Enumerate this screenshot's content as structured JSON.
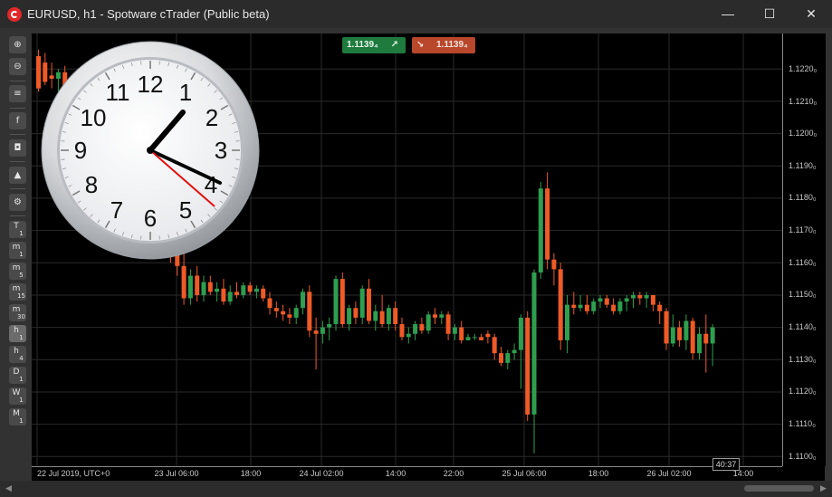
{
  "window": {
    "title": "EURUSD, h1 - Spotware cTrader (Public beta)",
    "minimize_glyph": "—",
    "maximize_glyph": "☐",
    "close_glyph": "✕"
  },
  "toolbar": {
    "tools": [
      {
        "name": "zoom-in-icon",
        "glyph": "⊕"
      },
      {
        "name": "zoom-out-icon",
        "glyph": "⊖"
      },
      {
        "name": "chart-type-icon",
        "glyph": "≡"
      },
      {
        "name": "facebook-icon",
        "glyph": "f"
      },
      {
        "name": "robot-icon",
        "glyph": "◘"
      },
      {
        "name": "objects-icon",
        "glyph": "▲"
      },
      {
        "name": "chart-settings-icon",
        "glyph": "⚙"
      }
    ],
    "timeframes": [
      {
        "main": "T",
        "sub": "1",
        "active": false
      },
      {
        "main": "m",
        "sub": "1",
        "active": false
      },
      {
        "main": "m",
        "sub": "5",
        "active": false
      },
      {
        "main": "m",
        "sub": "15",
        "active": false
      },
      {
        "main": "m",
        "sub": "30",
        "active": false
      },
      {
        "main": "h",
        "sub": "1",
        "active": true
      },
      {
        "main": "h",
        "sub": "4",
        "active": false
      },
      {
        "main": "D",
        "sub": "1",
        "active": false
      },
      {
        "main": "W",
        "sub": "1",
        "active": false
      },
      {
        "main": "M",
        "sub": "1",
        "active": false
      }
    ]
  },
  "quote": {
    "bid": "1.1139₄",
    "ask": "1.1139₄",
    "bid_arrow": "↗",
    "ask_arrow": "↘",
    "bid_color": "#1f7a3d",
    "ask_color": "#b8472b"
  },
  "price_axis": {
    "ticks": [
      "1.1220₀",
      "1.1210₀",
      "1.1200₀",
      "1.1190₀",
      "1.1180₀",
      "1.1170₀",
      "1.1160₀",
      "1.1150₀",
      "1.1140₀",
      "1.1130₀",
      "1.1120₀",
      "1.1110₀",
      "1.1100₀"
    ]
  },
  "time_axis": {
    "ticks": [
      "22 Jul 2019, UTC+0",
      "23 Jul 06:00",
      "18:00",
      "24 Jul 02:00",
      "14:00",
      "22:00",
      "25 Jul 06:00",
      "18:00",
      "26 Jul 02:00",
      "14:00"
    ]
  },
  "countdown": "40:37",
  "colors": {
    "bull": "#2e9e4f",
    "bear": "#ef5a26",
    "grid": "#2a2a2a",
    "background": "#000000"
  },
  "chart_data": {
    "type": "candlestick",
    "symbol": "EURUSD",
    "timeframe": "h1",
    "ylim": [
      1.1097,
      1.1231
    ],
    "candles": [
      {
        "o": 1.1224,
        "h": 1.1226,
        "l": 1.1213,
        "c": 1.1214
      },
      {
        "o": 1.1222,
        "h": 1.1225,
        "l": 1.1215,
        "c": 1.1216
      },
      {
        "o": 1.1218,
        "h": 1.1222,
        "l": 1.1214,
        "c": 1.1217
      },
      {
        "o": 1.1217,
        "h": 1.122,
        "l": 1.1213,
        "c": 1.1219
      },
      {
        "o": 1.1219,
        "h": 1.1221,
        "l": 1.1214,
        "c": 1.1215
      },
      {
        "o": 1.1215,
        "h": 1.1218,
        "l": 1.1212,
        "c": 1.1217
      },
      {
        "o": 1.1217,
        "h": 1.1219,
        "l": 1.1213,
        "c": 1.1214
      },
      {
        "o": 1.1214,
        "h": 1.1217,
        "l": 1.121,
        "c": 1.1216
      },
      {
        "o": 1.1216,
        "h": 1.1219,
        "l": 1.1212,
        "c": 1.1213
      },
      {
        "o": 1.1213,
        "h": 1.1216,
        "l": 1.1209,
        "c": 1.1215
      },
      {
        "o": 1.1215,
        "h": 1.1217,
        "l": 1.1208,
        "c": 1.121
      },
      {
        "o": 1.121,
        "h": 1.1213,
        "l": 1.1205,
        "c": 1.1208
      },
      {
        "o": 1.1208,
        "h": 1.1211,
        "l": 1.1202,
        "c": 1.1204
      },
      {
        "o": 1.1204,
        "h": 1.1207,
        "l": 1.1198,
        "c": 1.12
      },
      {
        "o": 1.12,
        "h": 1.1204,
        "l": 1.1195,
        "c": 1.1198
      },
      {
        "o": 1.1198,
        "h": 1.1201,
        "l": 1.119,
        "c": 1.1192
      },
      {
        "o": 1.1192,
        "h": 1.1195,
        "l": 1.1184,
        "c": 1.1186
      },
      {
        "o": 1.1186,
        "h": 1.119,
        "l": 1.1178,
        "c": 1.118
      },
      {
        "o": 1.118,
        "h": 1.1184,
        "l": 1.1172,
        "c": 1.1175
      },
      {
        "o": 1.1175,
        "h": 1.1178,
        "l": 1.1166,
        "c": 1.1168
      },
      {
        "o": 1.1168,
        "h": 1.1172,
        "l": 1.116,
        "c": 1.1163
      },
      {
        "o": 1.1163,
        "h": 1.1166,
        "l": 1.1156,
        "c": 1.1159
      },
      {
        "o": 1.1159,
        "h": 1.1163,
        "l": 1.1147,
        "c": 1.1149
      },
      {
        "o": 1.1149,
        "h": 1.1158,
        "l": 1.1147,
        "c": 1.1156
      },
      {
        "o": 1.1156,
        "h": 1.1159,
        "l": 1.1148,
        "c": 1.115
      },
      {
        "o": 1.115,
        "h": 1.1156,
        "l": 1.1148,
        "c": 1.1154
      },
      {
        "o": 1.1154,
        "h": 1.1156,
        "l": 1.115,
        "c": 1.1151
      },
      {
        "o": 1.1151,
        "h": 1.1154,
        "l": 1.1148,
        "c": 1.1152
      },
      {
        "o": 1.1152,
        "h": 1.1155,
        "l": 1.1147,
        "c": 1.1148
      },
      {
        "o": 1.1148,
        "h": 1.1153,
        "l": 1.1147,
        "c": 1.1151
      },
      {
        "o": 1.1151,
        "h": 1.1154,
        "l": 1.1149,
        "c": 1.115
      },
      {
        "o": 1.115,
        "h": 1.1154,
        "l": 1.1149,
        "c": 1.1153
      },
      {
        "o": 1.1153,
        "h": 1.1154,
        "l": 1.115,
        "c": 1.1151
      },
      {
        "o": 1.1151,
        "h": 1.1153,
        "l": 1.1149,
        "c": 1.1152
      },
      {
        "o": 1.1152,
        "h": 1.1153,
        "l": 1.1148,
        "c": 1.1149
      },
      {
        "o": 1.1149,
        "h": 1.1151,
        "l": 1.1144,
        "c": 1.1146
      },
      {
        "o": 1.1146,
        "h": 1.1148,
        "l": 1.1143,
        "c": 1.1145
      },
      {
        "o": 1.1145,
        "h": 1.1147,
        "l": 1.1142,
        "c": 1.1144
      },
      {
        "o": 1.1144,
        "h": 1.1146,
        "l": 1.1141,
        "c": 1.1143
      },
      {
        "o": 1.1143,
        "h": 1.1147,
        "l": 1.1141,
        "c": 1.1146
      },
      {
        "o": 1.1146,
        "h": 1.1152,
        "l": 1.1144,
        "c": 1.1151
      },
      {
        "o": 1.1151,
        "h": 1.1153,
        "l": 1.1137,
        "c": 1.1139
      },
      {
        "o": 1.1139,
        "h": 1.1143,
        "l": 1.1127,
        "c": 1.1138
      },
      {
        "o": 1.1138,
        "h": 1.1142,
        "l": 1.1135,
        "c": 1.114
      },
      {
        "o": 1.114,
        "h": 1.1143,
        "l": 1.1136,
        "c": 1.1141
      },
      {
        "o": 1.1141,
        "h": 1.1156,
        "l": 1.1139,
        "c": 1.1155
      },
      {
        "o": 1.1155,
        "h": 1.1157,
        "l": 1.114,
        "c": 1.1141
      },
      {
        "o": 1.1141,
        "h": 1.1147,
        "l": 1.1139,
        "c": 1.1146
      },
      {
        "o": 1.1146,
        "h": 1.1148,
        "l": 1.1141,
        "c": 1.1143
      },
      {
        "o": 1.1143,
        "h": 1.1153,
        "l": 1.1141,
        "c": 1.1152
      },
      {
        "o": 1.1152,
        "h": 1.1155,
        "l": 1.1141,
        "c": 1.1142
      },
      {
        "o": 1.1142,
        "h": 1.1147,
        "l": 1.1139,
        "c": 1.1145
      },
      {
        "o": 1.1145,
        "h": 1.115,
        "l": 1.114,
        "c": 1.1141
      },
      {
        "o": 1.1141,
        "h": 1.1147,
        "l": 1.1139,
        "c": 1.1146
      },
      {
        "o": 1.1146,
        "h": 1.1148,
        "l": 1.1139,
        "c": 1.1141
      },
      {
        "o": 1.1141,
        "h": 1.1143,
        "l": 1.1136,
        "c": 1.1137
      },
      {
        "o": 1.1137,
        "h": 1.114,
        "l": 1.1135,
        "c": 1.1138
      },
      {
        "o": 1.1138,
        "h": 1.1142,
        "l": 1.1136,
        "c": 1.1141
      },
      {
        "o": 1.1141,
        "h": 1.1143,
        "l": 1.1138,
        "c": 1.1139
      },
      {
        "o": 1.1139,
        "h": 1.1145,
        "l": 1.1138,
        "c": 1.1144
      },
      {
        "o": 1.1144,
        "h": 1.1146,
        "l": 1.1141,
        "c": 1.1143
      },
      {
        "o": 1.1143,
        "h": 1.1145,
        "l": 1.1141,
        "c": 1.1144
      },
      {
        "o": 1.1144,
        "h": 1.1145,
        "l": 1.1136,
        "c": 1.1138
      },
      {
        "o": 1.1138,
        "h": 1.1141,
        "l": 1.1136,
        "c": 1.114
      },
      {
        "o": 1.114,
        "h": 1.1142,
        "l": 1.1135,
        "c": 1.1136
      },
      {
        "o": 1.1136,
        "h": 1.1138,
        "l": 1.1136,
        "c": 1.1137
      },
      {
        "o": 1.1137,
        "h": 1.1138,
        "l": 1.1136,
        "c": 1.1137
      },
      {
        "o": 1.1137,
        "h": 1.1138,
        "l": 1.1136,
        "c": 1.1136
      },
      {
        "o": 1.1138,
        "h": 1.1139,
        "l": 1.1135,
        "c": 1.1137
      },
      {
        "o": 1.1137,
        "h": 1.1138,
        "l": 1.113,
        "c": 1.1132
      },
      {
        "o": 1.1132,
        "h": 1.1134,
        "l": 1.1128,
        "c": 1.1129
      },
      {
        "o": 1.1129,
        "h": 1.1133,
        "l": 1.1127,
        "c": 1.1132
      },
      {
        "o": 1.1132,
        "h": 1.1135,
        "l": 1.113,
        "c": 1.1133
      },
      {
        "o": 1.1133,
        "h": 1.1144,
        "l": 1.1121,
        "c": 1.1143
      },
      {
        "o": 1.1143,
        "h": 1.1145,
        "l": 1.1111,
        "c": 1.1113
      },
      {
        "o": 1.1113,
        "h": 1.1158,
        "l": 1.1101,
        "c": 1.1157
      },
      {
        "o": 1.1157,
        "h": 1.1185,
        "l": 1.1155,
        "c": 1.1183
      },
      {
        "o": 1.1183,
        "h": 1.1188,
        "l": 1.1158,
        "c": 1.1161
      },
      {
        "o": 1.1161,
        "h": 1.1163,
        "l": 1.1153,
        "c": 1.1158
      },
      {
        "o": 1.1158,
        "h": 1.116,
        "l": 1.1133,
        "c": 1.1136
      },
      {
        "o": 1.1136,
        "h": 1.115,
        "l": 1.1132,
        "c": 1.1147
      },
      {
        "o": 1.1147,
        "h": 1.1151,
        "l": 1.1144,
        "c": 1.1146
      },
      {
        "o": 1.1146,
        "h": 1.115,
        "l": 1.1145,
        "c": 1.1147
      },
      {
        "o": 1.1147,
        "h": 1.115,
        "l": 1.1144,
        "c": 1.1145
      },
      {
        "o": 1.1145,
        "h": 1.1149,
        "l": 1.1144,
        "c": 1.1148
      },
      {
        "o": 1.1148,
        "h": 1.115,
        "l": 1.1146,
        "c": 1.1149
      },
      {
        "o": 1.1149,
        "h": 1.115,
        "l": 1.1146,
        "c": 1.1147
      },
      {
        "o": 1.1147,
        "h": 1.1149,
        "l": 1.1144,
        "c": 1.1145
      },
      {
        "o": 1.1145,
        "h": 1.1149,
        "l": 1.1144,
        "c": 1.1148
      },
      {
        "o": 1.1148,
        "h": 1.115,
        "l": 1.1145,
        "c": 1.1149
      },
      {
        "o": 1.1149,
        "h": 1.1151,
        "l": 1.1146,
        "c": 1.115
      },
      {
        "o": 1.115,
        "h": 1.1151,
        "l": 1.1147,
        "c": 1.1149
      },
      {
        "o": 1.1149,
        "h": 1.1151,
        "l": 1.1146,
        "c": 1.115
      },
      {
        "o": 1.115,
        "h": 1.115,
        "l": 1.1145,
        "c": 1.1147
      },
      {
        "o": 1.1147,
        "h": 1.1148,
        "l": 1.1141,
        "c": 1.1145
      },
      {
        "o": 1.1145,
        "h": 1.1146,
        "l": 1.1133,
        "c": 1.1135
      },
      {
        "o": 1.1135,
        "h": 1.1144,
        "l": 1.1134,
        "c": 1.114
      },
      {
        "o": 1.114,
        "h": 1.1142,
        "l": 1.1134,
        "c": 1.1136
      },
      {
        "o": 1.1136,
        "h": 1.1144,
        "l": 1.1133,
        "c": 1.1142
      },
      {
        "o": 1.1142,
        "h": 1.1143,
        "l": 1.113,
        "c": 1.1132
      },
      {
        "o": 1.1132,
        "h": 1.114,
        "l": 1.113,
        "c": 1.1138
      },
      {
        "o": 1.1138,
        "h": 1.1144,
        "l": 1.1126,
        "c": 1.1135
      },
      {
        "o": 1.1135,
        "h": 1.1141,
        "l": 1.1128,
        "c": 1.114
      }
    ]
  }
}
